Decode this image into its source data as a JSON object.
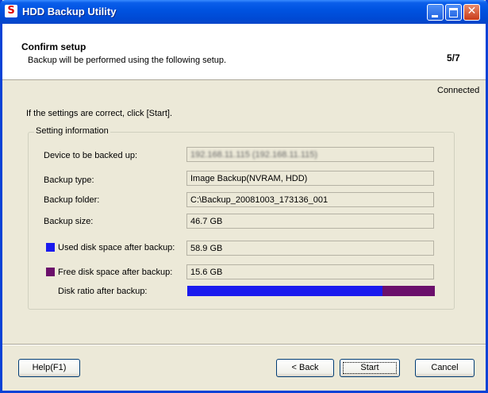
{
  "window": {
    "title": "HDD Backup Utility",
    "app_icon": "S"
  },
  "header": {
    "title": "Confirm setup",
    "subtitle": "Backup will be performed using the following setup.",
    "step": "5/7"
  },
  "status": "Connected",
  "instruction": "If the settings are correct, click [Start].",
  "group": {
    "legend": "Setting information",
    "rows": [
      {
        "label": "Device to be backed up:",
        "value": "192.168.11.115 (192.168.11.115)"
      },
      {
        "label": "Backup type:",
        "value": "Image Backup(NVRAM, HDD)"
      },
      {
        "label": "Backup folder:",
        "value": "C:\\Backup_20081003_173136_001"
      },
      {
        "label": "Backup size:",
        "value": "46.7 GB"
      },
      {
        "label": "Used disk space after backup:",
        "value": "58.9 GB"
      },
      {
        "label": "Free disk space after backup:",
        "value": "15.6 GB"
      }
    ],
    "ratio_label": "Disk ratio after backup:",
    "ratio_used_fraction": 0.79
  },
  "colors": {
    "used": "#1a1aee",
    "free": "#6b0f6b",
    "titlebar": "#0053e1"
  },
  "buttons": {
    "help": "Help(F1)",
    "back": "< Back",
    "start": "Start",
    "cancel": "Cancel"
  }
}
